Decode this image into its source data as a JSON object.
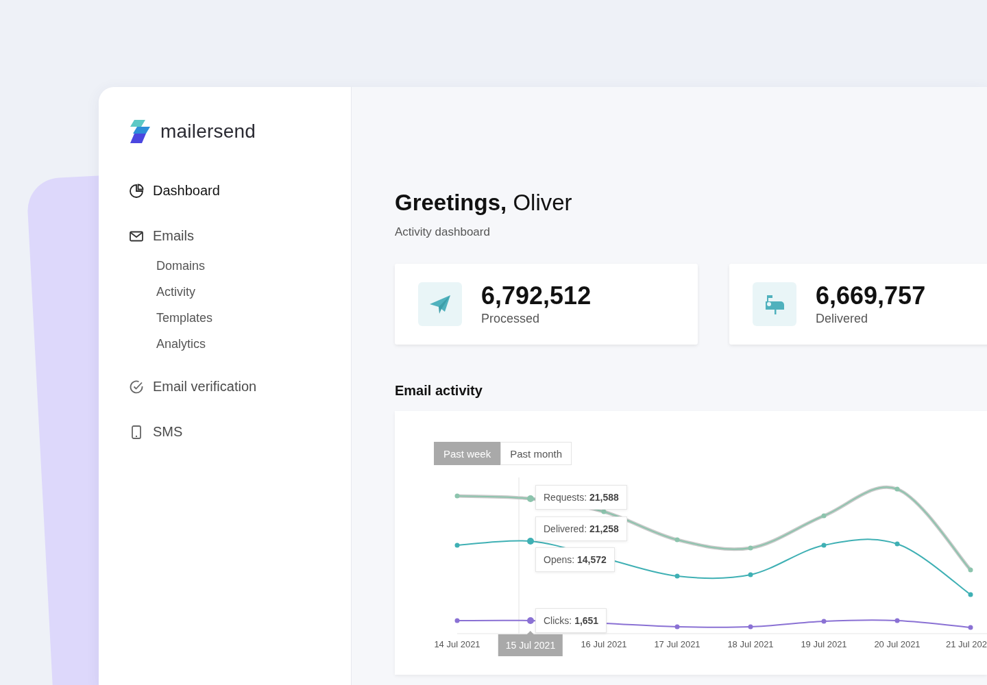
{
  "sidebar": {
    "logo": "mailersend",
    "nav": [
      {
        "label": "Dashboard",
        "selected": true
      },
      {
        "label": "Emails",
        "selected": false,
        "children": [
          {
            "label": "Domains"
          },
          {
            "label": "Activity"
          },
          {
            "label": "Templates"
          },
          {
            "label": "Analytics"
          }
        ]
      },
      {
        "label": "Email verification",
        "selected": false
      },
      {
        "label": "SMS",
        "selected": false
      }
    ]
  },
  "main": {
    "greeting": "**Greetings,** Oliver",
    "subtitle": "Activity dashboard",
    "stats": [
      {
        "value": "6,792,512",
        "label": "Processed"
      },
      {
        "value": "6,669,757",
        "label": "Delivered"
      }
    ],
    "section_title": "Email activity",
    "chart": {
      "ranges": [
        {
          "label": "Past week",
          "selected": true
        },
        {
          "label": "Past month",
          "selected": false
        }
      ],
      "tooltips": [
        "Requests: **21,588**",
        "Delivered: **21,258**",
        "Opens: **14,572**",
        "Clicks: **1,651**"
      ],
      "x_labels": [
        {
          "label": "14 Jul 2021",
          "selected": false
        },
        {
          "label": "15 Jul 2021",
          "selected": true
        },
        {
          "label": "16 Jul 2021",
          "selected": false
        },
        {
          "label": "17 Jul 2021",
          "selected": false
        },
        {
          "label": "18 Jul 2021",
          "selected": false
        },
        {
          "label": "19 Jul 2021",
          "selected": false
        },
        {
          "label": "20 Jul 2021",
          "selected": false
        },
        {
          "label": "21 Jul 202",
          "selected": false
        }
      ]
    }
  }
}
